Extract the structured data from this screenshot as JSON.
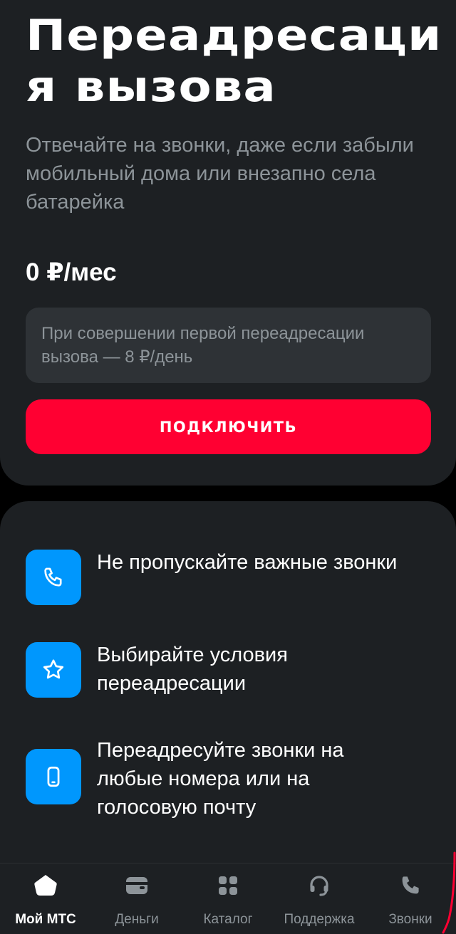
{
  "hero": {
    "title_line1": "Переадресаци",
    "title_line2": "я вызова",
    "subtitle": "Отвечайте на звонки, даже если забыли мобильный дома или внезапно села батарейка",
    "price": "0 ₽/мес",
    "note": "При совершении первой переадресации вызова — 8 ₽/день",
    "connect_label": "ПОДКЛЮЧИТЬ"
  },
  "features": [
    {
      "icon": "phone-icon",
      "text": "Не пропускайте важные звонки"
    },
    {
      "icon": "star-icon",
      "text": "Выбирайте условия переадресации"
    },
    {
      "icon": "smartphone-icon",
      "text": "Переадресуйте звонки на любые номера или на голосовую почту"
    }
  ],
  "tabbar": {
    "tabs": [
      {
        "icon": "home-icon",
        "label": "Мой МТС",
        "active": true
      },
      {
        "icon": "wallet-icon",
        "label": "Деньги",
        "active": false
      },
      {
        "icon": "grid-icon",
        "label": "Каталог",
        "active": false
      },
      {
        "icon": "headset-icon",
        "label": "Поддержка",
        "active": false
      },
      {
        "icon": "phone-icon",
        "label": "Звонки",
        "active": false
      }
    ]
  },
  "colors": {
    "background": "#000000",
    "card": "#1d2023",
    "accent_red": "#ff0032",
    "icon_blue": "#0097fd",
    "muted_text": "#8d9499",
    "note_bg": "#2e3236"
  }
}
